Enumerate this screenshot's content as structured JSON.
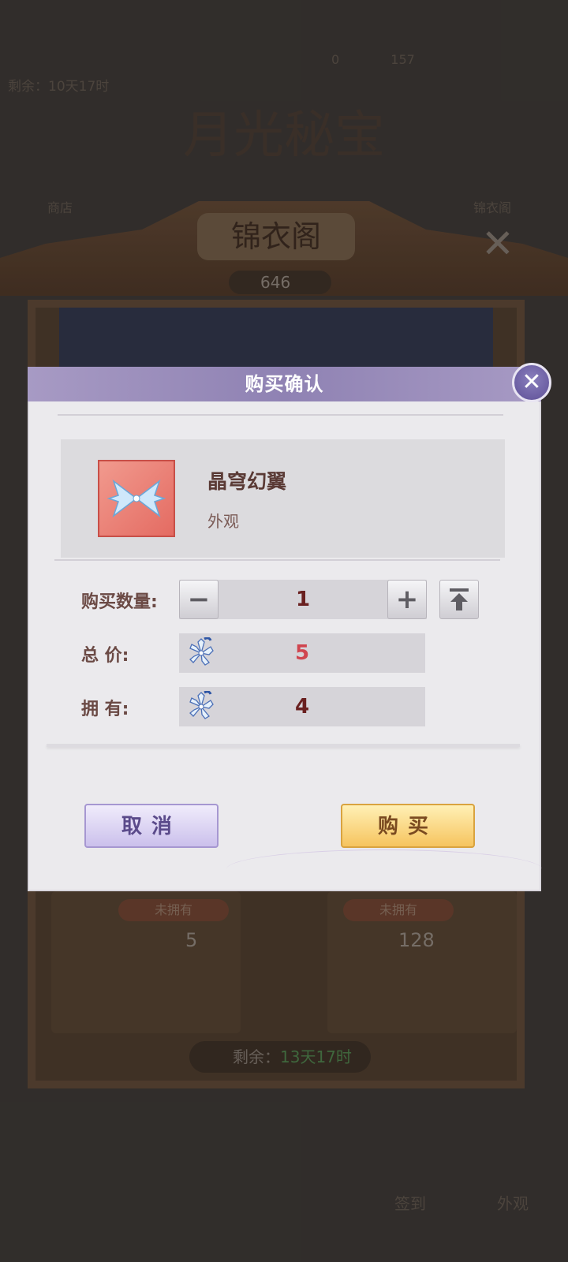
{
  "background": {
    "top_remaining": "剩余：10天17时",
    "top_stats": [
      "0",
      "157"
    ],
    "banner_title": "月光秘宝",
    "side_left": "商店",
    "side_right": "锦衣阁",
    "pavilion_name": "锦衣阁",
    "currency_amount": "646",
    "cards": [
      {
        "status": "未拥有",
        "price": "5"
      },
      {
        "status": "未拥有",
        "price": "128"
      }
    ],
    "bottom_remaining_label": "剩余：",
    "bottom_remaining_value": "13天17时",
    "bottom_nav": [
      "签到",
      "外观"
    ]
  },
  "dialog": {
    "title": "购买确认",
    "item": {
      "name": "晶穹幻翼",
      "type": "外观"
    },
    "quantity": {
      "label": "购买数量:",
      "value": "1"
    },
    "total_price": {
      "label": "总      价:",
      "value": "5"
    },
    "owned": {
      "label": "拥      有:",
      "value": "4"
    },
    "cancel_label": "取消",
    "buy_label": "购买"
  },
  "colors": {
    "header": "#8f82b3",
    "price_text": "#d0454f",
    "value_text": "#6a2020",
    "cancel": "#cbc0ec",
    "buy": "#f6c45f"
  },
  "icons": {
    "close": "close-icon",
    "minus": "minus-icon",
    "plus": "plus-icon",
    "max": "arrow-to-top-icon",
    "currency": "crystal-flower-icon",
    "item": "crystal-wing-icon"
  }
}
